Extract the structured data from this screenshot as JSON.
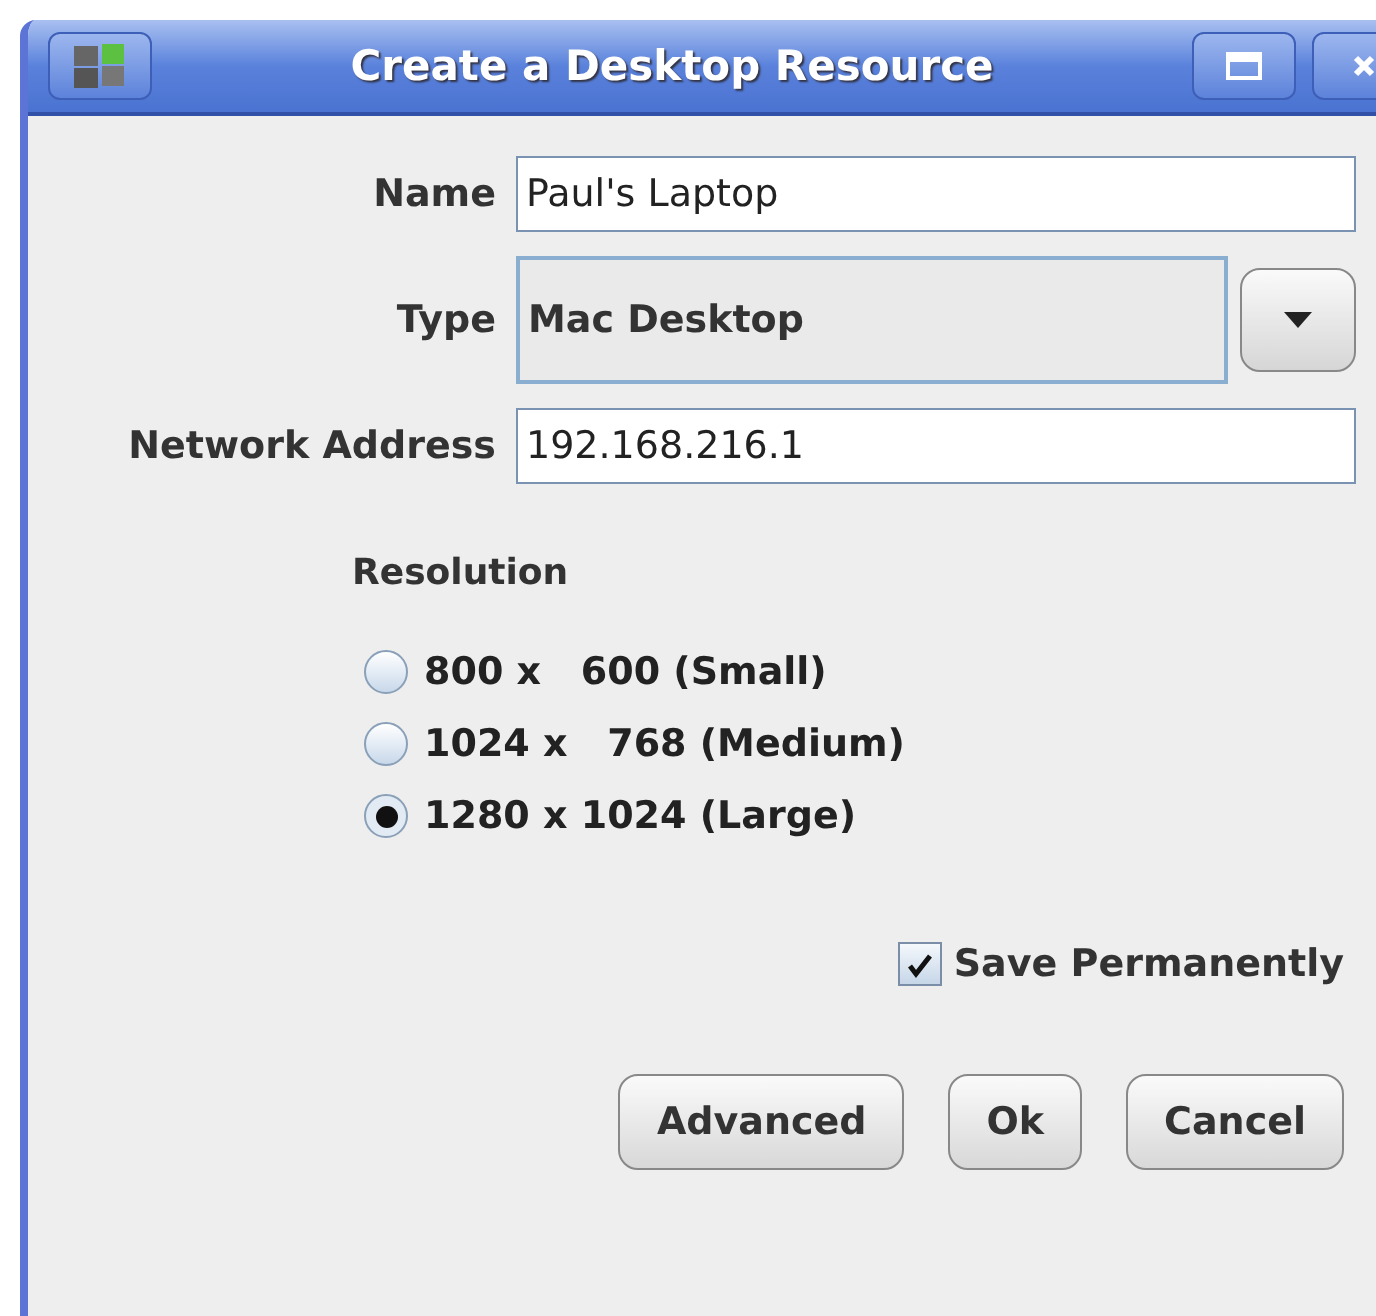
{
  "window": {
    "title": "Create a Desktop Resource"
  },
  "fields": [
    {
      "kind": "text",
      "label": "Name",
      "value": "Paul's Laptop"
    },
    {
      "kind": "select",
      "label": "Type",
      "value": "Mac Desktop"
    },
    {
      "kind": "text",
      "label": "Network Address",
      "value": "192.168.216.1"
    }
  ],
  "resolution": {
    "label": "Resolution",
    "options": [
      {
        "label": "800 x   600 (Small)",
        "selected": false
      },
      {
        "label": "1024 x   768 (Medium)",
        "selected": false
      },
      {
        "label": "1280 x 1024 (Large)",
        "selected": true
      }
    ]
  },
  "save_permanently": {
    "label": "Save Permanently",
    "checked": true
  },
  "buttons": [
    "Advanced",
    "Ok",
    "Cancel"
  ]
}
